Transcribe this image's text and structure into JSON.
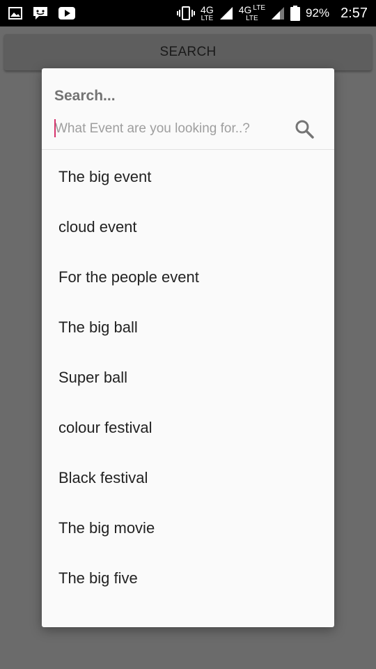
{
  "status_bar": {
    "network1_top": "4G",
    "network1_bottom": "LTE",
    "network2_top": "4G",
    "network2_bottom": "LTE",
    "network2_small": "LTE",
    "battery_percent": "92%",
    "time": "2:57",
    "icons": [
      "image-icon",
      "messenger-icon",
      "youtube-icon",
      "vibrate-icon",
      "signal-icon",
      "signal-icon",
      "battery-icon"
    ]
  },
  "app": {
    "search_button_label": "SEARCH"
  },
  "dialog": {
    "title": "Search...",
    "input_value": "",
    "input_placeholder": "What Event are you looking for..?",
    "items": [
      "The big event",
      "cloud event",
      "For the people event",
      "The big ball",
      "Super ball",
      "colour festival",
      "Black festival",
      "The big movie",
      "The big five"
    ]
  },
  "colors": {
    "accent_caret": "#d6336c",
    "dialog_bg": "#fafafa",
    "scrim": "#6b6b6b"
  }
}
